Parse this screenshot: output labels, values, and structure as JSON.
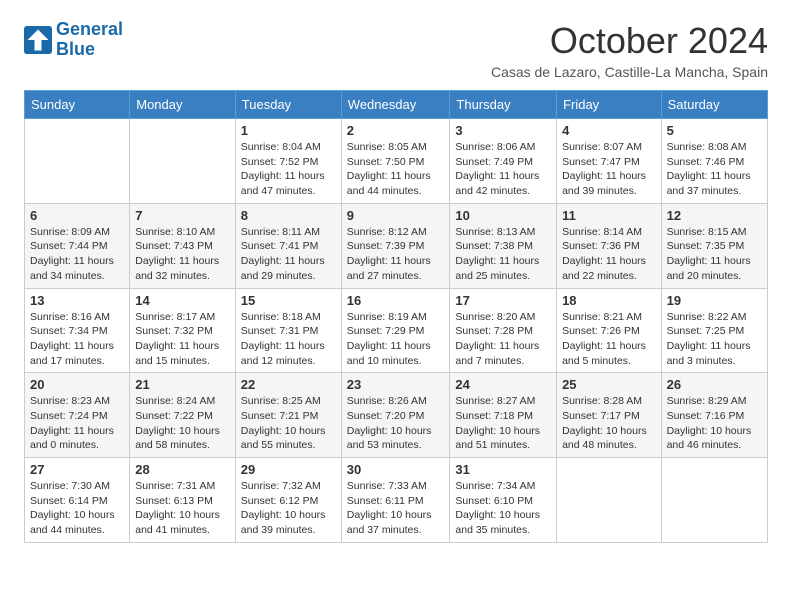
{
  "logo": {
    "line1": "General",
    "line2": "Blue"
  },
  "title": "October 2024",
  "subtitle": "Casas de Lazaro, Castille-La Mancha, Spain",
  "days_of_week": [
    "Sunday",
    "Monday",
    "Tuesday",
    "Wednesday",
    "Thursday",
    "Friday",
    "Saturday"
  ],
  "weeks": [
    [
      {
        "day": "",
        "info": ""
      },
      {
        "day": "",
        "info": ""
      },
      {
        "day": "1",
        "info": "Sunrise: 8:04 AM\nSunset: 7:52 PM\nDaylight: 11 hours and 47 minutes."
      },
      {
        "day": "2",
        "info": "Sunrise: 8:05 AM\nSunset: 7:50 PM\nDaylight: 11 hours and 44 minutes."
      },
      {
        "day": "3",
        "info": "Sunrise: 8:06 AM\nSunset: 7:49 PM\nDaylight: 11 hours and 42 minutes."
      },
      {
        "day": "4",
        "info": "Sunrise: 8:07 AM\nSunset: 7:47 PM\nDaylight: 11 hours and 39 minutes."
      },
      {
        "day": "5",
        "info": "Sunrise: 8:08 AM\nSunset: 7:46 PM\nDaylight: 11 hours and 37 minutes."
      }
    ],
    [
      {
        "day": "6",
        "info": "Sunrise: 8:09 AM\nSunset: 7:44 PM\nDaylight: 11 hours and 34 minutes."
      },
      {
        "day": "7",
        "info": "Sunrise: 8:10 AM\nSunset: 7:43 PM\nDaylight: 11 hours and 32 minutes."
      },
      {
        "day": "8",
        "info": "Sunrise: 8:11 AM\nSunset: 7:41 PM\nDaylight: 11 hours and 29 minutes."
      },
      {
        "day": "9",
        "info": "Sunrise: 8:12 AM\nSunset: 7:39 PM\nDaylight: 11 hours and 27 minutes."
      },
      {
        "day": "10",
        "info": "Sunrise: 8:13 AM\nSunset: 7:38 PM\nDaylight: 11 hours and 25 minutes."
      },
      {
        "day": "11",
        "info": "Sunrise: 8:14 AM\nSunset: 7:36 PM\nDaylight: 11 hours and 22 minutes."
      },
      {
        "day": "12",
        "info": "Sunrise: 8:15 AM\nSunset: 7:35 PM\nDaylight: 11 hours and 20 minutes."
      }
    ],
    [
      {
        "day": "13",
        "info": "Sunrise: 8:16 AM\nSunset: 7:34 PM\nDaylight: 11 hours and 17 minutes."
      },
      {
        "day": "14",
        "info": "Sunrise: 8:17 AM\nSunset: 7:32 PM\nDaylight: 11 hours and 15 minutes."
      },
      {
        "day": "15",
        "info": "Sunrise: 8:18 AM\nSunset: 7:31 PM\nDaylight: 11 hours and 12 minutes."
      },
      {
        "day": "16",
        "info": "Sunrise: 8:19 AM\nSunset: 7:29 PM\nDaylight: 11 hours and 10 minutes."
      },
      {
        "day": "17",
        "info": "Sunrise: 8:20 AM\nSunset: 7:28 PM\nDaylight: 11 hours and 7 minutes."
      },
      {
        "day": "18",
        "info": "Sunrise: 8:21 AM\nSunset: 7:26 PM\nDaylight: 11 hours and 5 minutes."
      },
      {
        "day": "19",
        "info": "Sunrise: 8:22 AM\nSunset: 7:25 PM\nDaylight: 11 hours and 3 minutes."
      }
    ],
    [
      {
        "day": "20",
        "info": "Sunrise: 8:23 AM\nSunset: 7:24 PM\nDaylight: 11 hours and 0 minutes."
      },
      {
        "day": "21",
        "info": "Sunrise: 8:24 AM\nSunset: 7:22 PM\nDaylight: 10 hours and 58 minutes."
      },
      {
        "day": "22",
        "info": "Sunrise: 8:25 AM\nSunset: 7:21 PM\nDaylight: 10 hours and 55 minutes."
      },
      {
        "day": "23",
        "info": "Sunrise: 8:26 AM\nSunset: 7:20 PM\nDaylight: 10 hours and 53 minutes."
      },
      {
        "day": "24",
        "info": "Sunrise: 8:27 AM\nSunset: 7:18 PM\nDaylight: 10 hours and 51 minutes."
      },
      {
        "day": "25",
        "info": "Sunrise: 8:28 AM\nSunset: 7:17 PM\nDaylight: 10 hours and 48 minutes."
      },
      {
        "day": "26",
        "info": "Sunrise: 8:29 AM\nSunset: 7:16 PM\nDaylight: 10 hours and 46 minutes."
      }
    ],
    [
      {
        "day": "27",
        "info": "Sunrise: 7:30 AM\nSunset: 6:14 PM\nDaylight: 10 hours and 44 minutes."
      },
      {
        "day": "28",
        "info": "Sunrise: 7:31 AM\nSunset: 6:13 PM\nDaylight: 10 hours and 41 minutes."
      },
      {
        "day": "29",
        "info": "Sunrise: 7:32 AM\nSunset: 6:12 PM\nDaylight: 10 hours and 39 minutes."
      },
      {
        "day": "30",
        "info": "Sunrise: 7:33 AM\nSunset: 6:11 PM\nDaylight: 10 hours and 37 minutes."
      },
      {
        "day": "31",
        "info": "Sunrise: 7:34 AM\nSunset: 6:10 PM\nDaylight: 10 hours and 35 minutes."
      },
      {
        "day": "",
        "info": ""
      },
      {
        "day": "",
        "info": ""
      }
    ]
  ]
}
